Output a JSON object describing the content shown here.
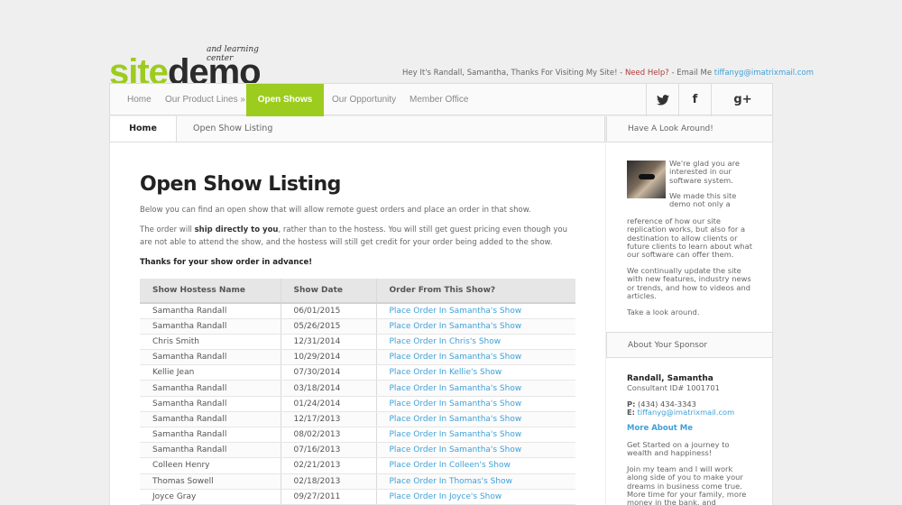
{
  "logo": {
    "tagline": "and learning center",
    "brand_green": "site",
    "brand_dark": "demo"
  },
  "greeting": {
    "text": "Hey It's Randall, Samantha, Thanks For Visiting My Site! - ",
    "help": "Need Help?",
    "email_label": " - Email Me ",
    "email": "tiffanyg@imatrixmail.com"
  },
  "nav": {
    "items": [
      "Home",
      "Our Product Lines »",
      "Open Shows",
      "Our Opportunity",
      "Member Office"
    ],
    "active": "Open Shows",
    "social": [
      "twitter-icon",
      "facebook-icon",
      "google-plus-icon"
    ]
  },
  "breadcrumb": {
    "home": "Home",
    "current": "Open Show Listing"
  },
  "main": {
    "title": "Open Show Listing",
    "intro": "Below you can find an open show that will allow remote guest orders and place an order in that show.",
    "para_pre": "The order will ",
    "para_bold": "ship directly to you",
    "para_post": ", rather than to the hostess. You will still get guest pricing even though you are not able to attend the show, and the hostess will still get credit for your order being added to the show.",
    "thanks": "Thanks for your show order in advance!",
    "table": {
      "headers": [
        "Show Hostess Name",
        "Show Date",
        "Order From This Show?"
      ],
      "rows": [
        [
          "Samantha Randall",
          "06/01/2015",
          "Place Order In Samantha's Show"
        ],
        [
          "Samantha Randall",
          "05/26/2015",
          "Place Order In Samantha's Show"
        ],
        [
          "Chris Smith",
          "12/31/2014",
          "Place Order In Chris's Show"
        ],
        [
          "Samantha Randall",
          "10/29/2014",
          "Place Order In Samantha's Show"
        ],
        [
          "Kellie Jean",
          "07/30/2014",
          "Place Order In Kellie's Show"
        ],
        [
          "Samantha Randall",
          "03/18/2014",
          "Place Order In Samantha's Show"
        ],
        [
          "Samantha Randall",
          "01/24/2014",
          "Place Order In Samantha's Show"
        ],
        [
          "Samantha Randall",
          "12/17/2013",
          "Place Order In Samantha's Show"
        ],
        [
          "Samantha Randall",
          "08/02/2013",
          "Place Order In Samantha's Show"
        ],
        [
          "Samantha Randall",
          "07/16/2013",
          "Place Order In Samantha's Show"
        ],
        [
          "Colleen Henry",
          "02/21/2013",
          "Place Order In Colleen's Show"
        ],
        [
          "Thomas Sowell",
          "02/18/2013",
          "Place Order In Thomas's Show"
        ],
        [
          "Joyce Gray",
          "09/27/2011",
          "Place Order In Joyce's Show"
        ]
      ]
    }
  },
  "sidebar": {
    "header1": "Have A Look Around!",
    "t1": "We're glad you are interested in our software system.",
    "t2": "We made this site demo not only a",
    "t2b": "reference of how our site replication works, but also for a destination to allow clients or future clients to learn about what our software can offer them.",
    "t3": "We continually update the site with new features, industry news or trends, and how to videos and articles.",
    "t4": "Take a look around.",
    "header2": "About Your Sponsor",
    "sponsor_name": "Randall, Samantha",
    "sponsor_id": "Consultant ID# 1001701",
    "phone_label": "P:",
    "phone": " (434) 434-3343",
    "email_label": "E:",
    "email": " tiffanyg@imatrixmail.com",
    "more": "More About Me",
    "t5": "Get Started on a journey to wealth and happiness!",
    "t6": "Join my team and I will work along side of you to make your dreams in business come true. More time for your family, more money in the bank, and"
  },
  "colors": {
    "accent": "#9ccc1e",
    "link": "#3fa0d8",
    "help": "#b03a3a"
  }
}
